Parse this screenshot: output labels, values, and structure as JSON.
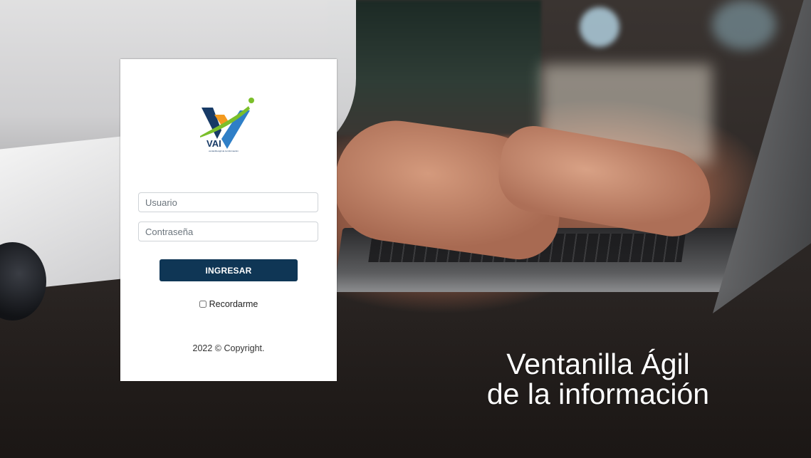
{
  "brand": {
    "logo_text": "VAI",
    "logo_tagline": "ventanilla ágil de la información",
    "colors": {
      "navy": "#173a66",
      "orange": "#f39a1e",
      "green": "#7bbf2a",
      "blue": "#2f7fc7"
    }
  },
  "login": {
    "username_placeholder": "Usuario",
    "password_placeholder": "Contraseña",
    "submit_label": "INGRESAR",
    "remember_label": "Recordarme",
    "remember_checked": false,
    "button_color": "#0f3655"
  },
  "footer": {
    "copyright": "2022 © Copyright."
  },
  "hero": {
    "line1": "Ventanilla Ágil",
    "line2": "de la información"
  }
}
